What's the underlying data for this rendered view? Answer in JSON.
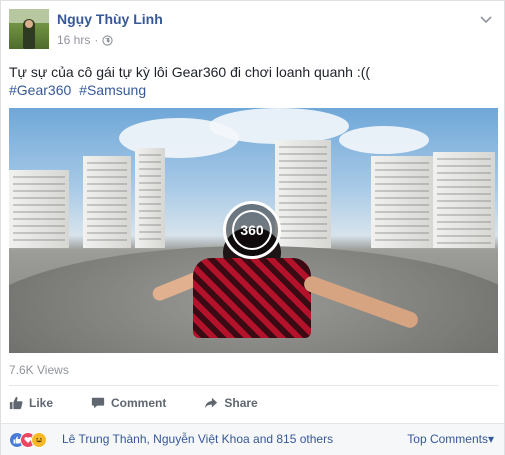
{
  "post": {
    "author": "Ngụy Thùy Linh",
    "time": "16 hrs",
    "separator": "·",
    "text": "Tự sự của cô gái tự kỳ lôi Gear360 đi chơi loanh quanh :((",
    "hashtags": [
      "#Gear360",
      "#Samsung"
    ]
  },
  "video": {
    "badge": "360",
    "views": "7.6K Views"
  },
  "actions": {
    "like": "Like",
    "comment": "Comment",
    "share": "Share"
  },
  "reactions": {
    "names": "Lê Trung Thành, Nguyễn Việt Khoa and 815 others",
    "top_comments": "Top Comments",
    "top_comments_arrow": "▾"
  },
  "icons": {
    "globe": "globe-icon",
    "chevron": "chevron-down-icon",
    "like": "thumbs-up-icon",
    "comment": "comment-bubble-icon",
    "share": "share-arrow-icon"
  },
  "colors": {
    "link": "#365899",
    "meta": "#90949c",
    "like_reaction": "#4a7bd8",
    "love_reaction": "#ec4661",
    "haha_reaction": "#f7b928"
  }
}
